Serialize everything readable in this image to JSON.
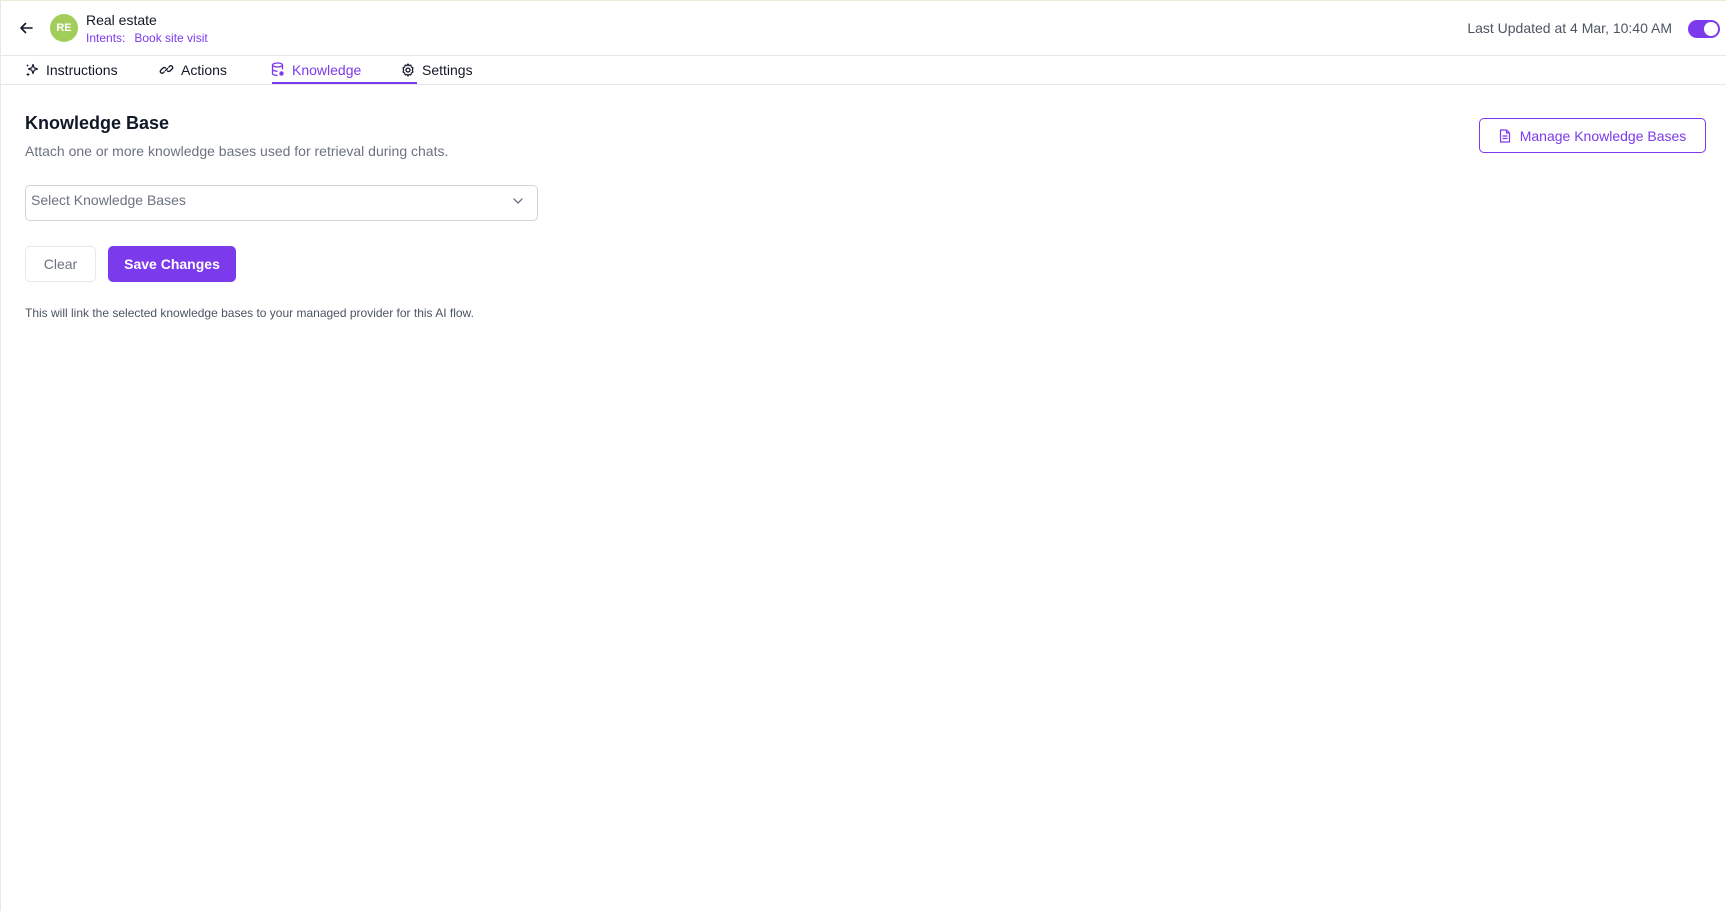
{
  "header": {
    "back_icon": "arrow-left-icon",
    "avatar_initials": "RE",
    "avatar_color": "#a3cd5a",
    "agent_name": "Real estate",
    "intents_label": "Intents:",
    "intents_value": "Book site visit",
    "last_updated": "Last Updated at 4 Mar, 10:40 AM",
    "toggle_on": true
  },
  "tabs": [
    {
      "label": "Instructions",
      "icon": "sparkles-icon",
      "active": false
    },
    {
      "label": "Actions",
      "icon": "link-icon",
      "active": false
    },
    {
      "label": "Knowledge",
      "icon": "database-icon",
      "active": true
    },
    {
      "label": "Settings",
      "icon": "gear-icon",
      "active": false
    }
  ],
  "main": {
    "title": "Knowledge Base",
    "subtitle": "Attach one or more knowledge bases used for retrieval during chats.",
    "manage_button": "Manage Knowledge Bases",
    "select_placeholder": "Select Knowledge Bases",
    "clear_button": "Clear",
    "save_button": "Save Changes",
    "footnote": "This will link the selected knowledge bases to your managed provider for this AI flow."
  },
  "colors": {
    "accent": "#7c3aed",
    "avatar": "#a3cd5a"
  }
}
